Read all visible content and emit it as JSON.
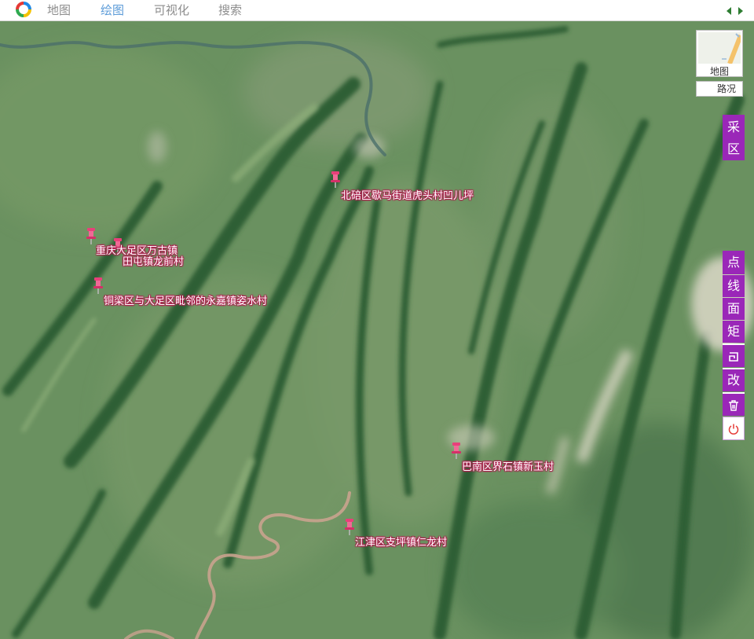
{
  "nav": {
    "tabs": [
      {
        "label": "地图",
        "active": false
      },
      {
        "label": "绘图",
        "active": true
      },
      {
        "label": "可视化",
        "active": false
      },
      {
        "label": "搜索",
        "active": false
      }
    ],
    "prev_icon": "arrow-left-icon",
    "next_icon": "arrow-right-icon"
  },
  "map_controls": {
    "map_type_label": "地图",
    "traffic_label": "路况"
  },
  "collect_tool": {
    "chars": [
      "采",
      "区"
    ]
  },
  "draw_tools": {
    "point": "点",
    "line": "线",
    "polygon": "面",
    "rectangle": "矩",
    "undo_icon": "undo-icon",
    "edit": "改",
    "delete_icon": "trash-icon",
    "power_icon": "power-icon"
  },
  "markers": [
    {
      "label": "北碚区歇马街道虎头村凹儿坪"
    },
    {
      "label": "重庆大足区万古镇"
    },
    {
      "label": "田屯镇龙前村"
    },
    {
      "label": "铜梁区与大足区毗邻的永嘉镇姿水村"
    },
    {
      "label": "巴南区界石镇新玉村"
    },
    {
      "label": "江津区支坪镇仁龙村"
    }
  ],
  "colors": {
    "accent": "#9a27b8",
    "active_tab": "#5b9bd8",
    "marker": "#e8407a"
  }
}
